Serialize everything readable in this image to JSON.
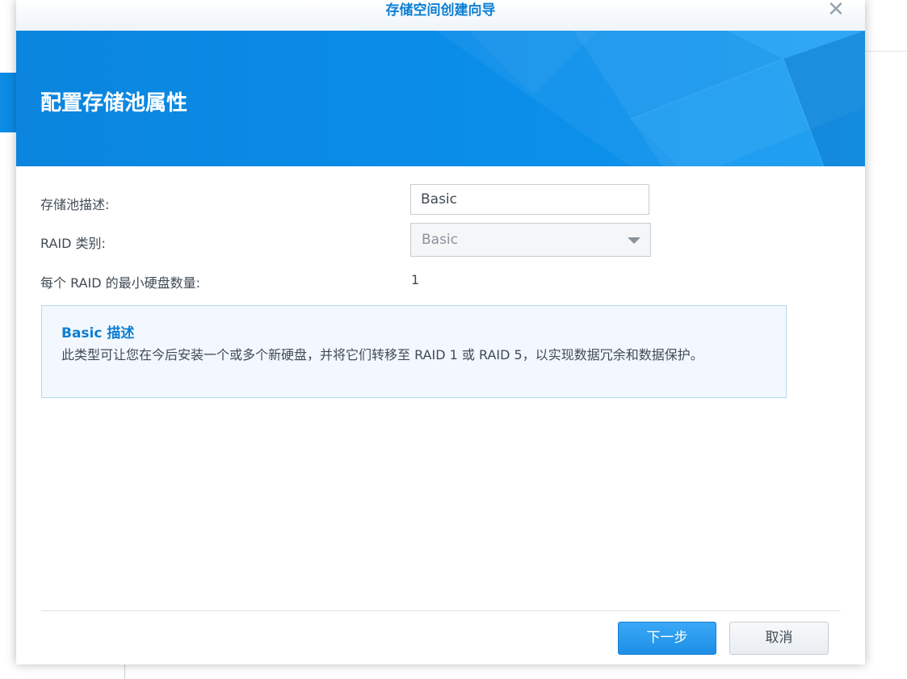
{
  "dialog": {
    "title": "存储空间创建向导",
    "close_glyph": "✕",
    "banner_title": "配置存储池属性"
  },
  "form": {
    "description_label": "存储池描述:",
    "description_value": "Basic",
    "raid_label": "RAID 类别:",
    "raid_value": "Basic",
    "min_disks_label": "每个 RAID 的最小硬盘数量:",
    "min_disks_value": "1"
  },
  "info": {
    "title": "Basic 描述",
    "text": "此类型可让您在今后安装一个或多个新硬盘，并将它们转移至 RAID 1 或 RAID 5，以实现数据冗余和数据保护。"
  },
  "buttons": {
    "next": "下一步",
    "cancel": "取消"
  },
  "icons": {
    "close": "close-icon",
    "dropdown": "chevron-down-icon"
  },
  "colors": {
    "accent": "#0d7fd3",
    "banner": "#0a8ce8",
    "primary_button": "#1c8fe6"
  }
}
